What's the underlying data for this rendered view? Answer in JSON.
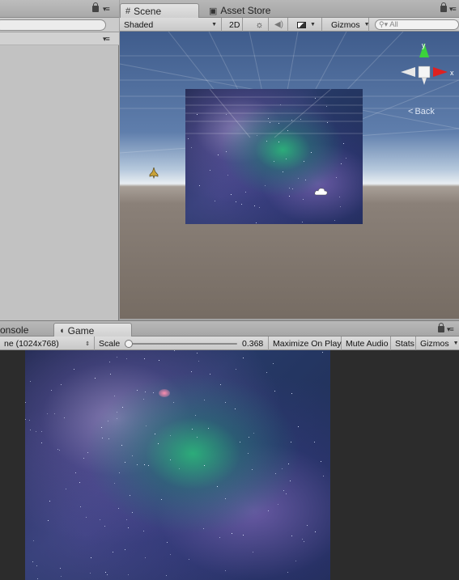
{
  "top_tabs": {
    "scene_label": "Scene",
    "asset_store_label": "Asset Store"
  },
  "scene_toolbar": {
    "shading_mode": "Shaded",
    "mode_2d": "2D",
    "gizmos_label": "Gizmos",
    "search_placeholder": "All"
  },
  "scene_view": {
    "gizmo_axes": [
      "y",
      "x"
    ],
    "back_label": "Back"
  },
  "bottom_tabs": {
    "console_label": "onsole",
    "game_label": "Game"
  },
  "game_toolbar": {
    "display_label": "ne (1024x768)",
    "scale_label": "Scale",
    "scale_value": "0.368",
    "scale_fraction": 0.03,
    "maximize_on_play": "Maximize On Play",
    "mute_audio": "Mute Audio",
    "stats": "Stats",
    "gizmos": "Gizmos"
  }
}
